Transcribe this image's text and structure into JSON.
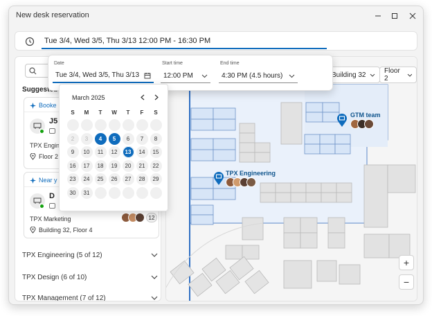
{
  "window": {
    "title": "New desk reservation"
  },
  "timebar": {
    "value": "Tue 3/4, Wed 3/5, Thu 3/13 12:00 PM - 16:30 PM"
  },
  "popup": {
    "date_label": "Date",
    "date_value": "Tue 3/4, Wed 3/5, Thu 3/13",
    "start_label": "Start time",
    "start_value": "12:00 PM",
    "end_label": "End time",
    "end_value": "4:30 PM (4.5 hours)"
  },
  "calendar": {
    "month": "March 2025",
    "dow": [
      "S",
      "M",
      "T",
      "W",
      "T",
      "F",
      "S"
    ],
    "weeks": [
      [
        "",
        "",
        "",
        "",
        "",
        "",
        ""
      ],
      [
        "2",
        "3",
        "4",
        "5",
        "6",
        "7",
        "8"
      ],
      [
        "9",
        "10",
        "11",
        "12",
        "13",
        "14",
        "15"
      ],
      [
        "16",
        "17",
        "18",
        "19",
        "20",
        "21",
        "22"
      ],
      [
        "23",
        "24",
        "25",
        "26",
        "27",
        "28",
        "29"
      ],
      [
        "30",
        "31",
        "",
        "",
        "",
        "",
        ""
      ]
    ],
    "selected": [
      "4",
      "5",
      "13"
    ],
    "muted": [
      "2",
      "3"
    ]
  },
  "left": {
    "suggested": "Suggested",
    "card1": {
      "tag": "Booke",
      "desk": "J5",
      "team": "TPX Engine",
      "location": "Floor 2"
    },
    "card2": {
      "tag": "Near y",
      "desk": "D",
      "team": "TPX Marketing",
      "location": "Building 32, Floor 4",
      "count": "12"
    },
    "groups": [
      {
        "label": "TPX Engineering (5 of 12)"
      },
      {
        "label": "TPX Design (6 of 10)"
      },
      {
        "label": "TPX Management (7 of 12)"
      }
    ]
  },
  "map": {
    "building": "Building 32",
    "floor": "Floor 2",
    "pins": [
      {
        "label": "GTM team"
      },
      {
        "label": "TPX Engineering"
      }
    ],
    "zoom_in": "+",
    "zoom_out": "−"
  },
  "colors": {
    "accent": "#0f6cbd",
    "available": "#13a10e"
  }
}
